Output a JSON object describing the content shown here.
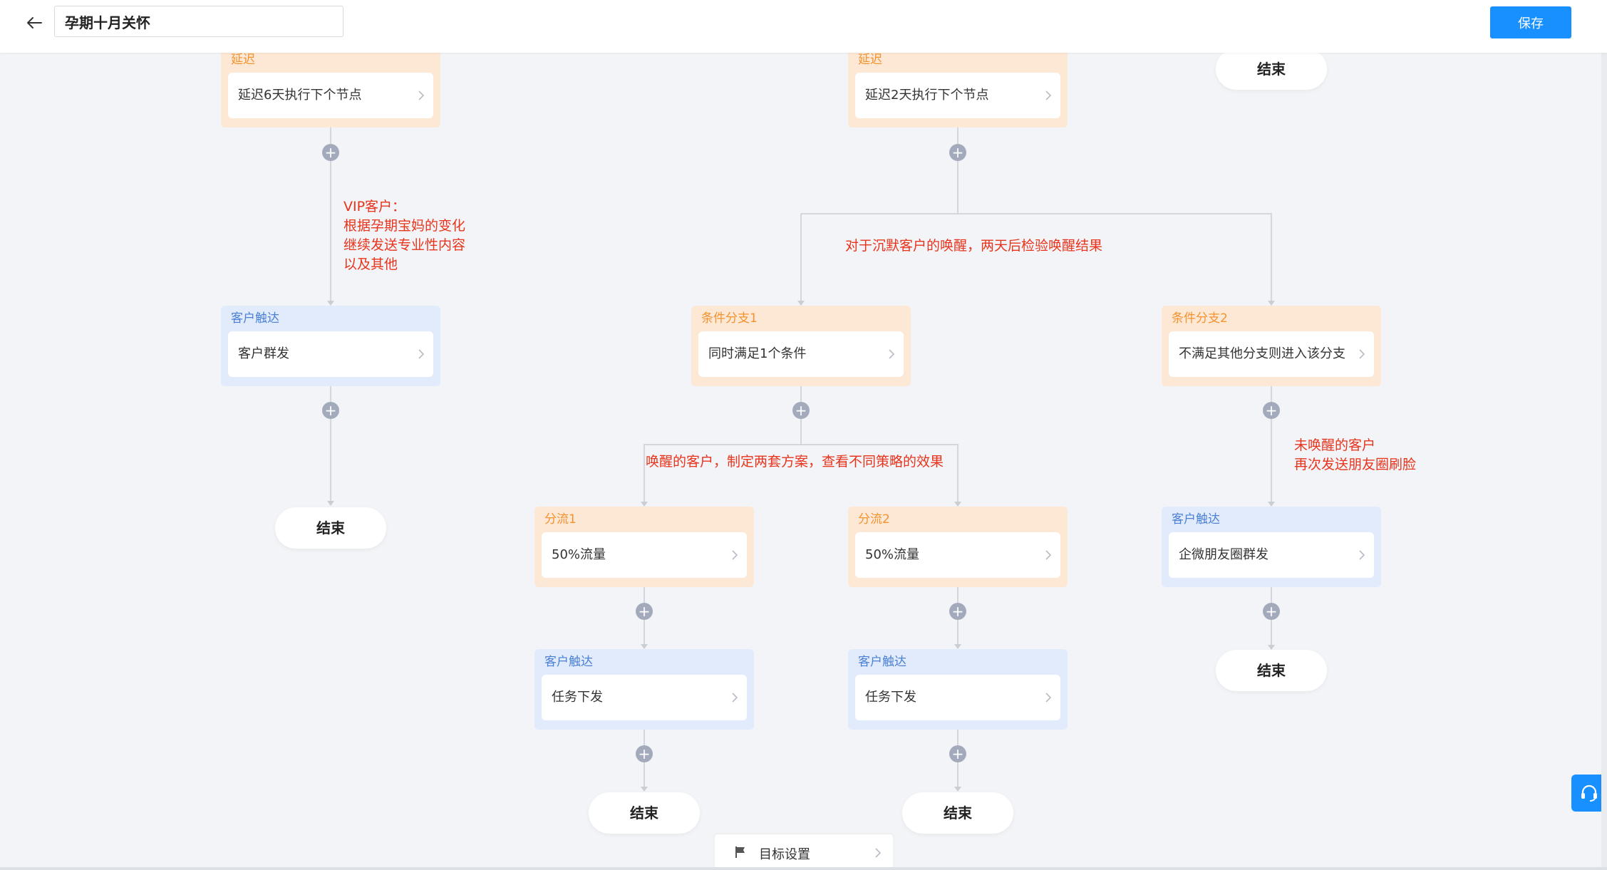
{
  "header": {
    "back_icon": "arrow-left-icon",
    "title_value": "孕期十月关怀",
    "save_label": "保存"
  },
  "colors": {
    "accent": "#1890ff",
    "delay_node_bg": "#fce8d5",
    "delay_node_label": "#f5922e",
    "touch_node_bg": "#e1ebfb",
    "touch_node_label": "#4a7fd6",
    "annotation": "#e8341c",
    "connector": "#c9cdd4",
    "plus_button": "#a2aabb"
  },
  "nodes": {
    "delay_left": {
      "type": "延迟",
      "text": "延迟6天执行下个节点"
    },
    "delay_mid": {
      "type": "延迟",
      "text": "延迟2天执行下个节点"
    },
    "touch_left": {
      "type": "客户触达",
      "text": "客户群发"
    },
    "branch1": {
      "type": "条件分支1",
      "text": "同时满足1个条件"
    },
    "branch2": {
      "type": "条件分支2",
      "text": "不满足其他分支则进入该分支"
    },
    "split1": {
      "type": "分流1",
      "text": "50%流量"
    },
    "split2": {
      "type": "分流2",
      "text": "50%流量"
    },
    "touch_moments": {
      "type": "客户触达",
      "text": "企微朋友圈群发"
    },
    "touch_task1": {
      "type": "客户触达",
      "text": "任务下发"
    },
    "touch_task2": {
      "type": "客户触达",
      "text": "任务下发"
    }
  },
  "end_label": "结束",
  "annotations": {
    "vip": "VIP客户：\n根据孕期宝妈的变化\n继续发送专业性内容\n以及其他",
    "silent": "对于沉默客户的唤醒，两天后检验唤醒结果",
    "awakened": "唤醒的客户，制定两套方案，查看不同策略的效果",
    "not_awakened": "未唤醒的客户\n再次发送朋友圈刷脸"
  },
  "goal_bar": {
    "icon": "flag-icon",
    "label": "目标设置"
  },
  "support": {
    "icon": "headset-icon"
  }
}
